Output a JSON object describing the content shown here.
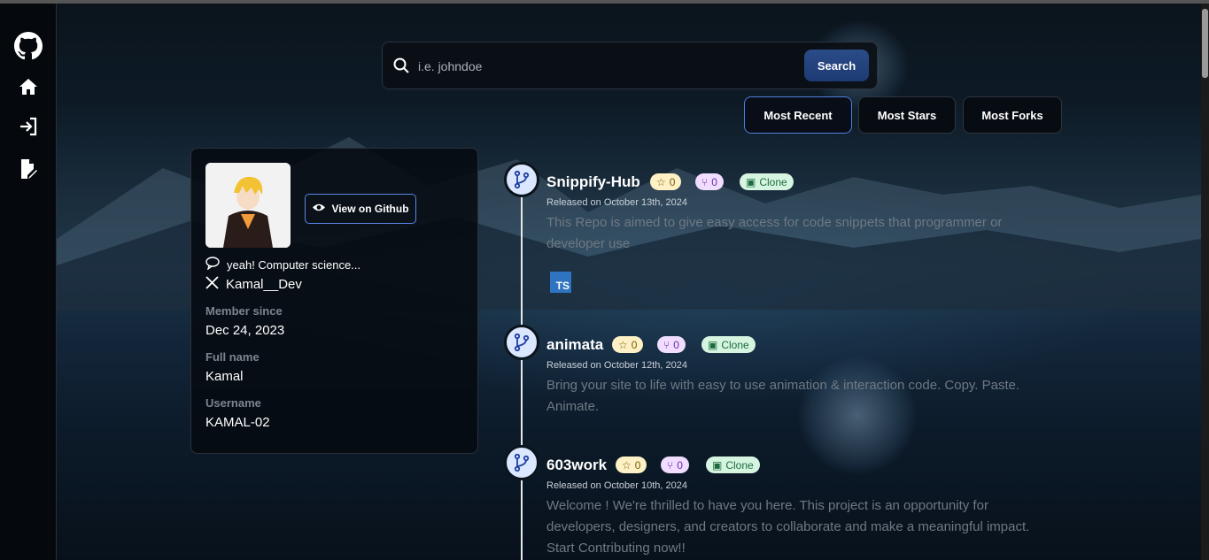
{
  "sidebar": {
    "items": [
      {
        "icon": "github-icon",
        "label": "GitHub"
      },
      {
        "icon": "home-icon",
        "label": "Home"
      },
      {
        "icon": "login-icon",
        "label": "Login"
      },
      {
        "icon": "signup-icon",
        "label": "Sign Up"
      }
    ]
  },
  "search": {
    "placeholder": "i.e. johndoe",
    "value": "",
    "button_label": "Search"
  },
  "sort": {
    "options": [
      "Most Recent",
      "Most Stars",
      "Most Forks"
    ],
    "active": "Most Recent"
  },
  "profile": {
    "view_github_label": "View on Github",
    "bio": "yeah! Computer science...",
    "twitter": "Kamal__Dev",
    "member_since_label": "Member since",
    "member_since": "Dec 24, 2023",
    "full_name_label": "Full name",
    "full_name": "Kamal",
    "username_label": "Username",
    "username": "KAMAL-02"
  },
  "repos": [
    {
      "name": "Snippify-Hub",
      "stars": "0",
      "forks": "0",
      "clone_label": "Clone",
      "released": "Released on October 13th, 2024",
      "description": "This Repo is aimed to give easy access for code snippets that programmer or developer use",
      "language": "TS"
    },
    {
      "name": "animata",
      "stars": "0",
      "forks": "0",
      "clone_label": "Clone",
      "released": "Released on October 12th, 2024",
      "description": "Bring your site to life with easy to use animation & interaction code. Copy. Paste. Animate."
    },
    {
      "name": "603work",
      "stars": "0",
      "forks": "0",
      "clone_label": "Clone",
      "released": "Released on October 10th, 2024",
      "description": "Welcome ! We're thrilled to have you here. This project is an opportunity for developers, designers, and creators to collaborate and make a meaningful impact. Start Contributing now!!"
    }
  ],
  "colors": {
    "accent": "#4f7fe0",
    "search_button": "#1d3a73",
    "star_badge": "#fdf1c5",
    "fork_badge": "#f0ddff",
    "clone_badge": "#d6f5e1"
  }
}
